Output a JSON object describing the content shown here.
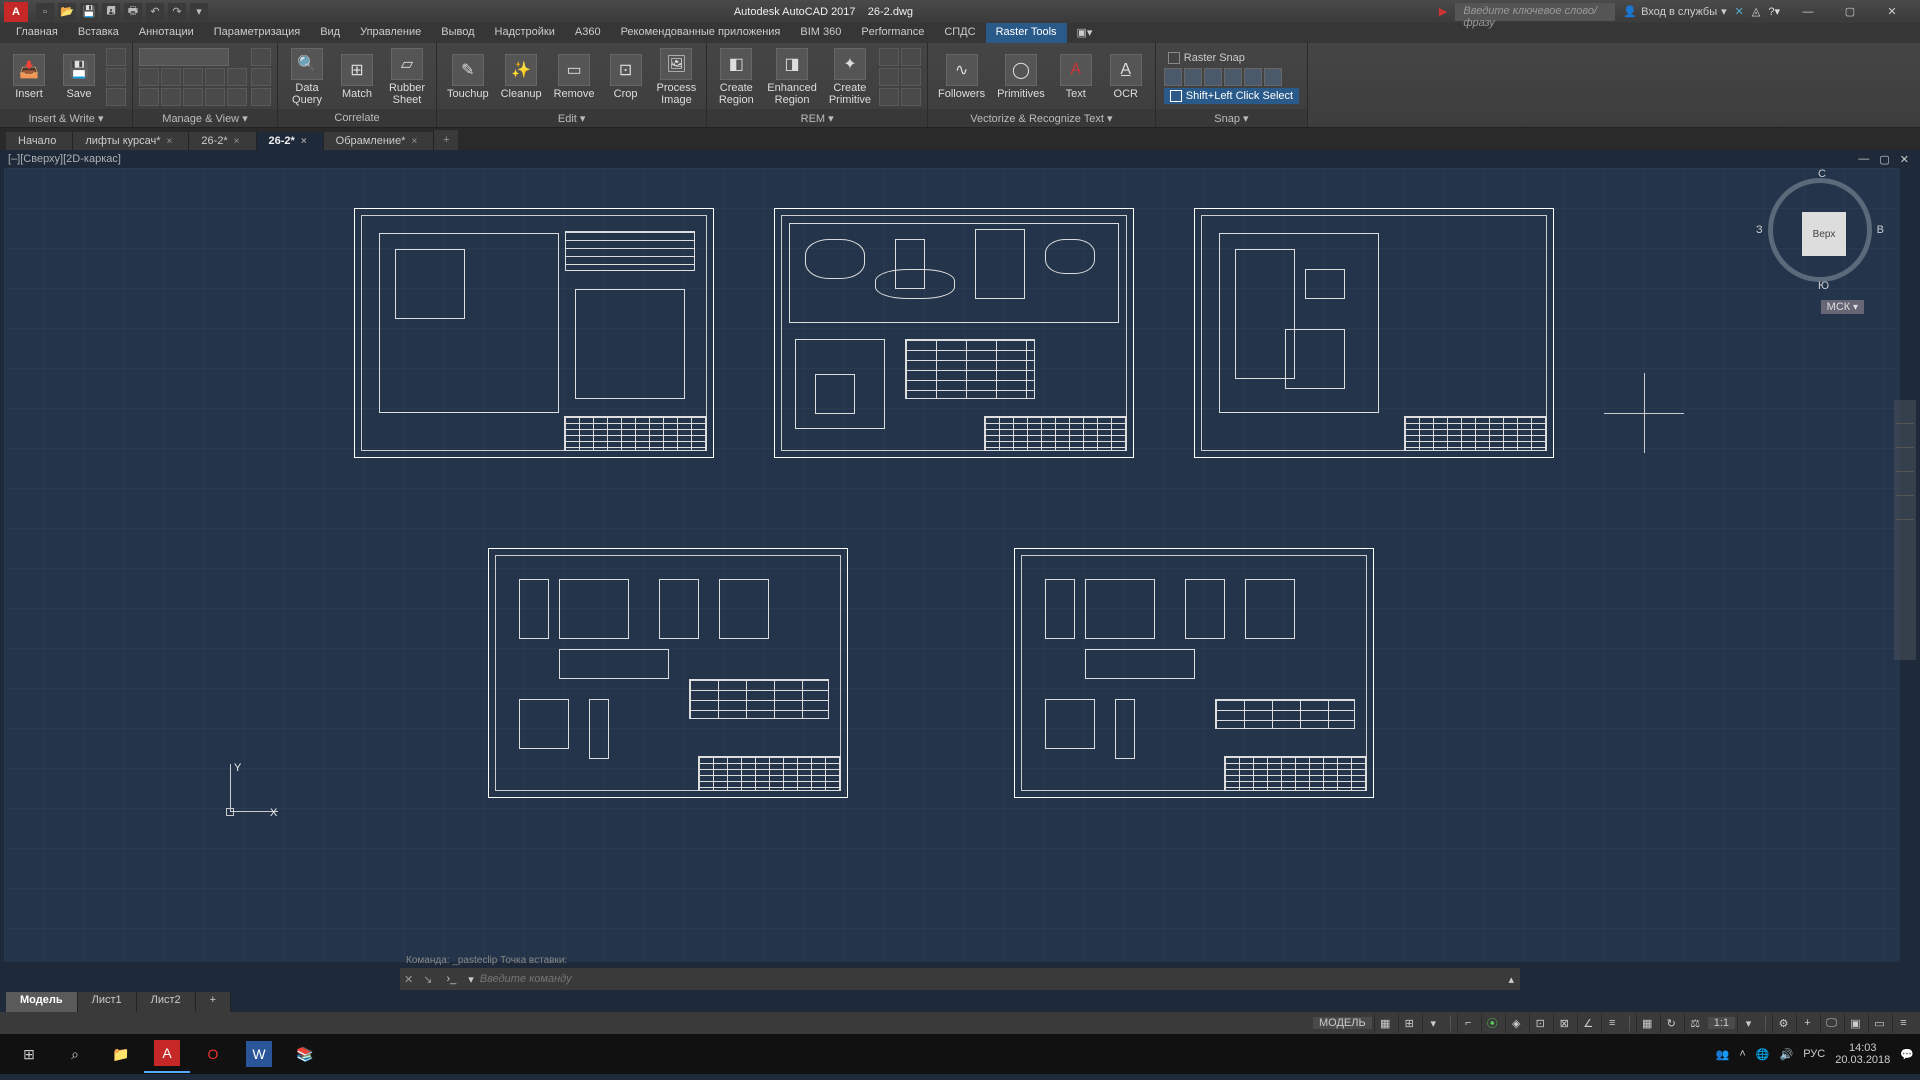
{
  "title": {
    "app": "Autodesk AutoCAD 2017",
    "file": "26-2.dwg"
  },
  "qat": [
    "new",
    "open",
    "save",
    "saveas",
    "plot",
    "undo",
    "redo"
  ],
  "search_placeholder": "Введите ключевое слово/фразу",
  "signin": "Вход в службы",
  "menus": [
    "Главная",
    "Вставка",
    "Аннотации",
    "Параметризация",
    "Вид",
    "Управление",
    "Вывод",
    "Надстройки",
    "A360",
    "Рекомендованные приложения",
    "BIM 360",
    "Performance",
    "СПДС",
    "Raster Tools"
  ],
  "active_menu": "Raster Tools",
  "ribbon": {
    "insert_write": {
      "title": "Insert & Write",
      "insert": "Insert",
      "save": "Save"
    },
    "manage_view": {
      "title": "Manage & View"
    },
    "correlate": {
      "title": "Correlate",
      "data_query": "Data\nQuery",
      "match": "Match",
      "rubber_sheet": "Rubber\nSheet"
    },
    "edit": {
      "title": "Edit",
      "touchup": "Touchup",
      "cleanup": "Cleanup",
      "remove": "Remove",
      "crop": "Crop",
      "process_image": "Process\nImage"
    },
    "rem": {
      "title": "REM",
      "create_region": "Create\nRegion",
      "enhanced_region": "Enhanced\nRegion",
      "create_primitive": "Create\nPrimitive"
    },
    "vectorize": {
      "title": "Vectorize & Recognize Text",
      "followers": "Followers",
      "primitives": "Primitives",
      "text": "Text",
      "ocr": "OCR"
    },
    "snap": {
      "title": "Snap",
      "raster_snap": "Raster Snap",
      "shift_select": "Shift+Left Click Select"
    }
  },
  "file_tabs": [
    {
      "label": "Начало",
      "close": false
    },
    {
      "label": "лифты курсач*",
      "close": true
    },
    {
      "label": "26-2*",
      "close": true
    },
    {
      "label": "26-2*",
      "close": true,
      "active": true
    },
    {
      "label": "Обрамление*",
      "close": true
    }
  ],
  "viewport_label": "[–][Сверху][2D-каркас]",
  "ucs": {
    "x": "X",
    "y": "Y"
  },
  "viewcube": {
    "top": "Верх",
    "n": "С",
    "e": "В",
    "s": "Ю",
    "w": "З",
    "wcs": "МСК"
  },
  "cmd_history": "Команда: _pasteclip Точка вставки:",
  "cmd_placeholder": "Введите команду",
  "model_tabs": [
    "Модель",
    "Лист1",
    "Лист2"
  ],
  "status": {
    "model": "МОДЕЛЬ",
    "scale": "1:1",
    "lang": "РУС"
  },
  "taskbar": {
    "time": "14:03",
    "date": "20.03.2018",
    "lang": "РУС"
  }
}
